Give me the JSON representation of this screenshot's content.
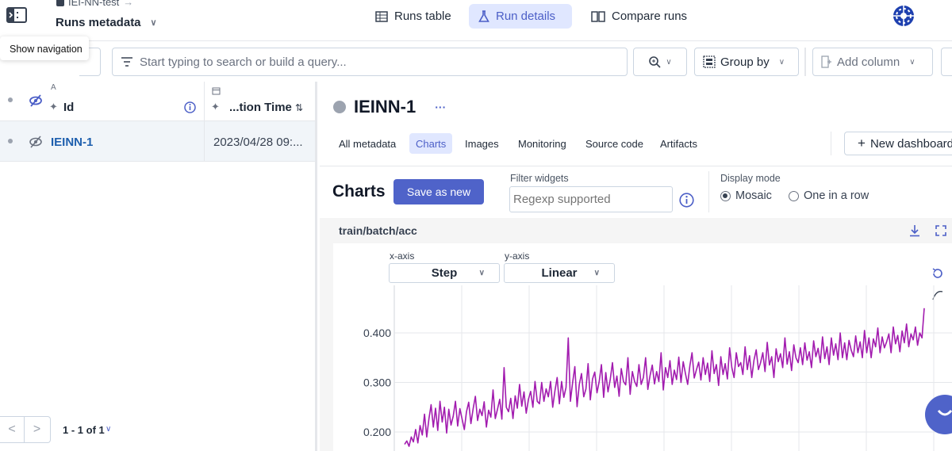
{
  "header": {
    "breadcrumb": "IEI-NN-test",
    "project_title": "Runs metadata",
    "tabs": [
      {
        "label": "Runs table",
        "icon": "table-icon",
        "active": false
      },
      {
        "label": "Run details",
        "icon": "flask-icon",
        "active": true
      },
      {
        "label": "Compare runs",
        "icon": "compare-icon",
        "active": false
      }
    ],
    "accent": "#4f63c9"
  },
  "tooltip": "Show navigation",
  "search": {
    "placeholder": "Start typing to search or build a query...",
    "group_by_label": "Group by",
    "add_column_label": "Add column"
  },
  "table": {
    "columns": [
      {
        "label": "Id",
        "sort_hint": "A"
      },
      {
        "label": "...tion Time"
      }
    ],
    "rows": [
      {
        "id": "IEINN-1",
        "time": "2023/04/28 09:..."
      }
    ],
    "pager": "1 - 1 of 1"
  },
  "run": {
    "name": "IEINN-1",
    "more": "···",
    "sub_tabs": [
      "All metadata",
      "Charts",
      "Images",
      "Monitoring",
      "Source code",
      "Artifacts"
    ],
    "active_sub_tab": "Charts",
    "new_dashboard": "New dashboard"
  },
  "charts_toolbar": {
    "title": "Charts",
    "save_label": "Save as new",
    "filter_label": "Filter widgets",
    "filter_placeholder": "Regexp supported",
    "display_mode_label": "Display mode",
    "mode_mosaic": "Mosaic",
    "mode_row": "One in a row",
    "selected_mode": "Mosaic"
  },
  "chart_panel": {
    "title": "train/batch/acc",
    "x_axis_label": "x-axis",
    "x_axis_value": "Step",
    "y_axis_label": "y-axis",
    "y_axis_value": "Linear"
  },
  "chart_data": {
    "type": "line",
    "title": "train/batch/acc",
    "xlabel": "",
    "ylabel": "",
    "yticks": [
      "0.400",
      "0.300",
      "0.200"
    ],
    "ylim": [
      0.17,
      0.475
    ],
    "series": [
      {
        "color": "#a21caf",
        "values": [
          0.175,
          0.182,
          0.171,
          0.19,
          0.18,
          0.205,
          0.178,
          0.213,
          0.194,
          0.236,
          0.19,
          0.227,
          0.255,
          0.21,
          0.248,
          0.203,
          0.262,
          0.22,
          0.25,
          0.198,
          0.246,
          0.214,
          0.232,
          0.262,
          0.212,
          0.247,
          0.226,
          0.205,
          0.241,
          0.26,
          0.217,
          0.247,
          0.272,
          0.223,
          0.246,
          0.233,
          0.261,
          0.21,
          0.244,
          0.23,
          0.285,
          0.227,
          0.246,
          0.266,
          0.226,
          0.33,
          0.25,
          0.241,
          0.268,
          0.227,
          0.273,
          0.248,
          0.296,
          0.252,
          0.281,
          0.238,
          0.266,
          0.282,
          0.25,
          0.302,
          0.262,
          0.257,
          0.3,
          0.262,
          0.287,
          0.271,
          0.302,
          0.25,
          0.283,
          0.31,
          0.257,
          0.302,
          0.27,
          0.29,
          0.39,
          0.262,
          0.3,
          0.332,
          0.251,
          0.296,
          0.318,
          0.271,
          0.287,
          0.338,
          0.265,
          0.307,
          0.321,
          0.279,
          0.302,
          0.336,
          0.27,
          0.32,
          0.281,
          0.306,
          0.34,
          0.29,
          0.313,
          0.272,
          0.328,
          0.302,
          0.295,
          0.35,
          0.276,
          0.322,
          0.302,
          0.292,
          0.336,
          0.296,
          0.31,
          0.35,
          0.286,
          0.314,
          0.335,
          0.297,
          0.322,
          0.302,
          0.36,
          0.285,
          0.33,
          0.31,
          0.344,
          0.296,
          0.325,
          0.306,
          0.351,
          0.3,
          0.342,
          0.318,
          0.296,
          0.334,
          0.36,
          0.309,
          0.326,
          0.341,
          0.305,
          0.35,
          0.316,
          0.339,
          0.302,
          0.364,
          0.318,
          0.336,
          0.294,
          0.352,
          0.316,
          0.338,
          0.307,
          0.37,
          0.33,
          0.31,
          0.36,
          0.332,
          0.34,
          0.316,
          0.372,
          0.326,
          0.354,
          0.31,
          0.345,
          0.366,
          0.326,
          0.34,
          0.36,
          0.322,
          0.381,
          0.335,
          0.352,
          0.31,
          0.368,
          0.342,
          0.358,
          0.33,
          0.39,
          0.337,
          0.362,
          0.324,
          0.376,
          0.35,
          0.34,
          0.37,
          0.336,
          0.38,
          0.345,
          0.362,
          0.33,
          0.384,
          0.352,
          0.369,
          0.34,
          0.392,
          0.348,
          0.372,
          0.336,
          0.39,
          0.355,
          0.378,
          0.346,
          0.4,
          0.35,
          0.38,
          0.346,
          0.385,
          0.365,
          0.352,
          0.394,
          0.36,
          0.382,
          0.35,
          0.405,
          0.36,
          0.39,
          0.35,
          0.388,
          0.372,
          0.41,
          0.36,
          0.392,
          0.37,
          0.382,
          0.398,
          0.36,
          0.412,
          0.378,
          0.395,
          0.362,
          0.404,
          0.38,
          0.418,
          0.372,
          0.398,
          0.386,
          0.412,
          0.375,
          0.4,
          0.39,
          0.45
        ]
      }
    ]
  }
}
